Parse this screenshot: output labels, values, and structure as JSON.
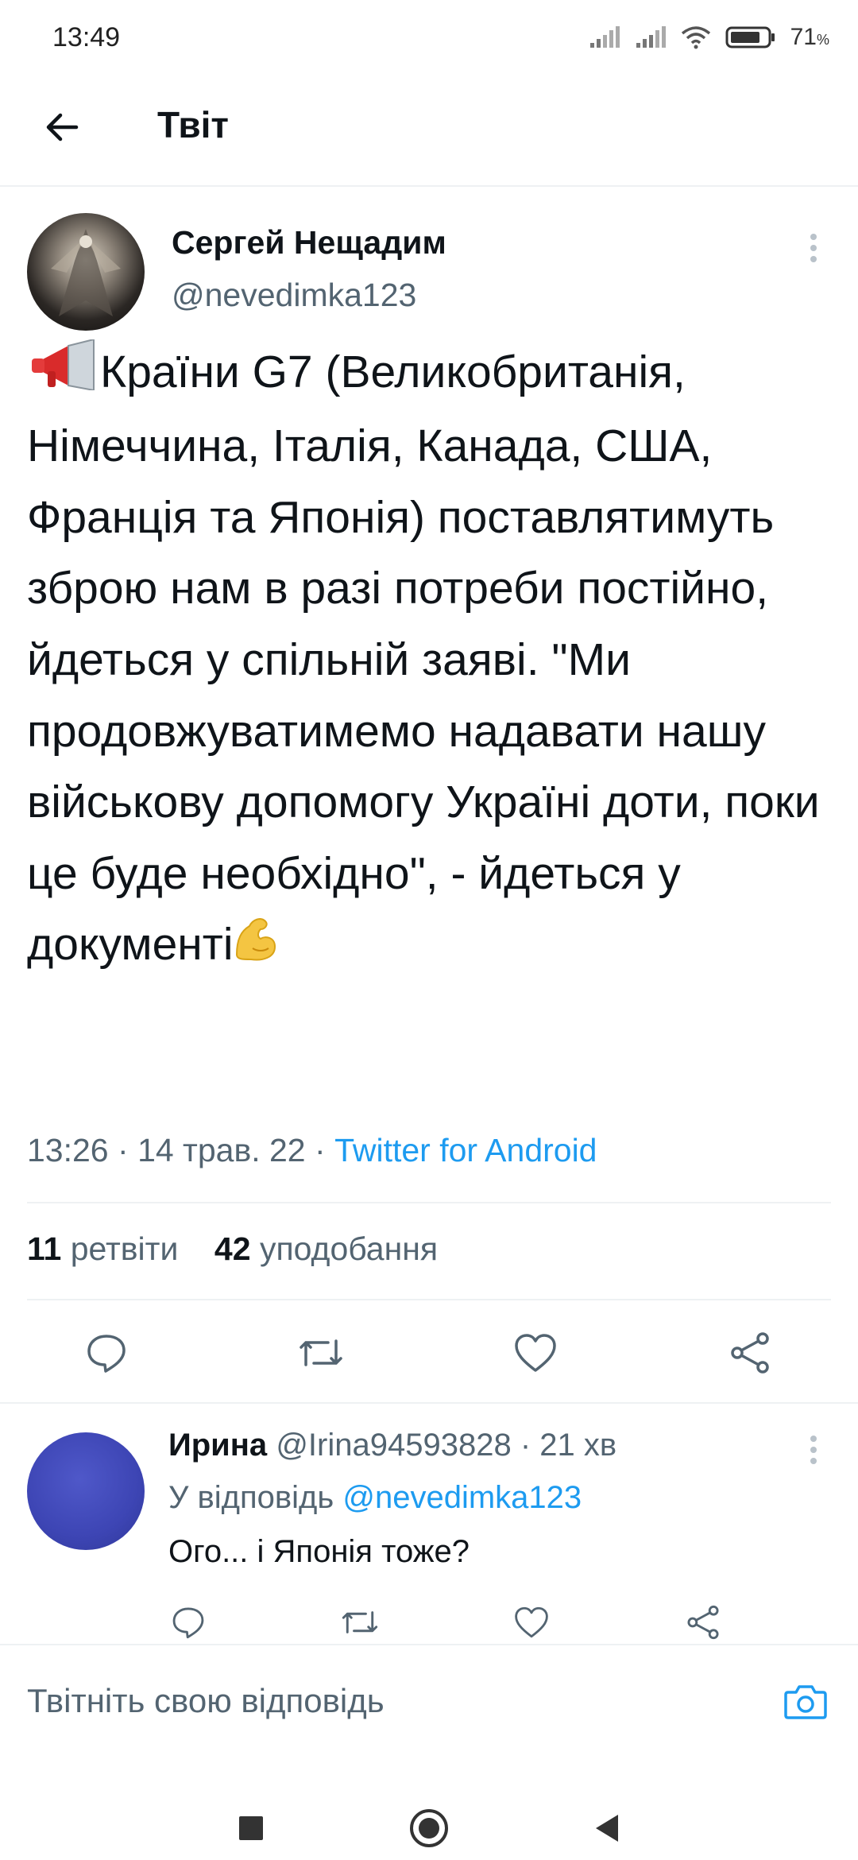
{
  "status_bar": {
    "time": "13:49",
    "battery": "71",
    "battery_unit": "%"
  },
  "header": {
    "title": "Твіт",
    "back_icon": "arrow-left-icon"
  },
  "tweet": {
    "author_name": "Сергей Нещадим",
    "author_handle": "@nevedimka123",
    "text_lead_emoji": "📢",
    "text": "Країни G7 (Великобританія, Німеччина, Італія, Канада, США, Франція та Японія) поставлятимуть зброю нам в разі потреби постійно, йдеться у спільній заяві. \"Ми продовжуватимемо надавати нашу військову допомогу Україні доти, поки це буде необхідно\", - йдеться у документі",
    "text_trail_emoji": "💪",
    "time": "13:26",
    "date": "14 трав. 22",
    "client": "Twitter for Android",
    "retweets_count": "11",
    "retweets_label": "ретвіти",
    "likes_count": "42",
    "likes_label": "уподобання"
  },
  "reply": {
    "name": "Ирина",
    "handle": "@Irina94593828",
    "time": "21 хв",
    "replying_to_label": "У відповідь",
    "replying_to_handle": "@nevedimka123",
    "text": "Ого... і Японія тоже?"
  },
  "compose": {
    "placeholder": "Твітніть свою відповідь"
  },
  "colors": {
    "accent": "#1d9bf0",
    "secondary_text": "#536471",
    "primary_text": "#0f1419"
  }
}
